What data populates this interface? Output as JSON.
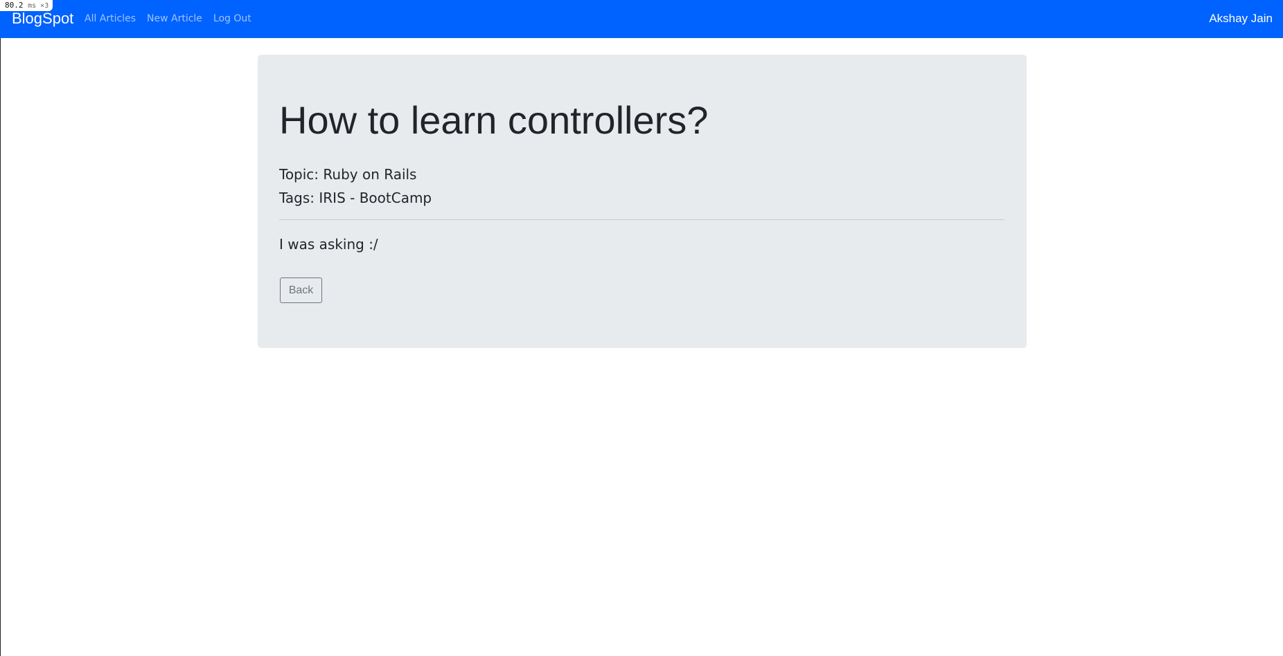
{
  "perf_badge": {
    "value": "80.2",
    "unit": "ms ×3"
  },
  "navbar": {
    "brand": "BlogSpot",
    "links": [
      {
        "label": "All Articles"
      },
      {
        "label": "New Article"
      },
      {
        "label": "Log Out"
      }
    ],
    "user_name": "Akshay Jain",
    "background_color": "#0062ff"
  },
  "article": {
    "title": "How to learn controllers?",
    "topic_line": "Topic: Ruby on Rails",
    "tags_line": "Tags: IRIS - BootCamp",
    "body": "I was asking :/",
    "back_label": "Back"
  }
}
